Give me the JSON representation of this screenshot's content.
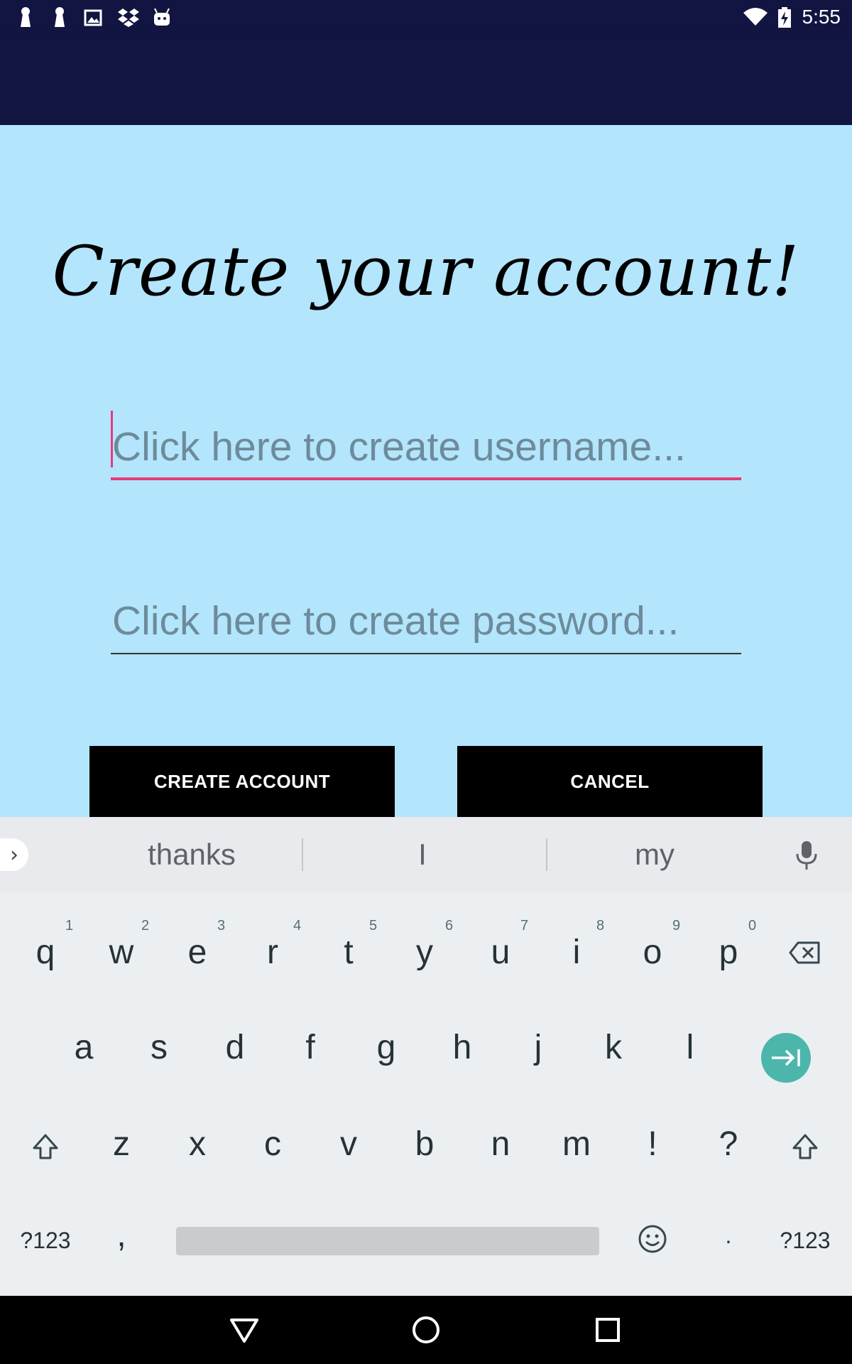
{
  "status_bar": {
    "time": "5:55",
    "left_icons": [
      "notification-icon",
      "notification-icon",
      "image-icon",
      "dropbox-icon",
      "android-icon"
    ],
    "right_icons": [
      "wifi-icon",
      "battery-charging-icon"
    ]
  },
  "screen": {
    "title": "Create your account!",
    "username_placeholder": "Click here to create username...",
    "password_placeholder": "Click here to create password...",
    "create_button": "CREATE ACCOUNT",
    "cancel_button": "CANCEL"
  },
  "keyboard": {
    "suggestions": [
      "thanks",
      "I",
      "my"
    ],
    "row1": [
      "q",
      "w",
      "e",
      "r",
      "t",
      "y",
      "u",
      "i",
      "o",
      "p"
    ],
    "row1_hints": [
      "1",
      "2",
      "3",
      "4",
      "5",
      "6",
      "7",
      "8",
      "9",
      "0"
    ],
    "row2": [
      "a",
      "s",
      "d",
      "f",
      "g",
      "h",
      "j",
      "k",
      "l"
    ],
    "row3": [
      "z",
      "x",
      "c",
      "v",
      "b",
      "n",
      "m",
      "!",
      "?"
    ],
    "symbols_left": "?123",
    "comma": ",",
    "period": "·",
    "symbols_right": "?123"
  },
  "colors": {
    "app_bar": "#121541",
    "background": "#b3e5fc",
    "accent": "#e63b7a",
    "enter_key": "#4db6ac"
  }
}
